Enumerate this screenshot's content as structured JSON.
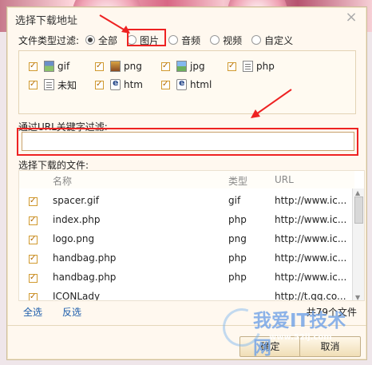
{
  "dialog": {
    "title": "选择下载地址",
    "close_icon": "close-icon"
  },
  "filters": {
    "label": "文件类型过滤:",
    "options": [
      {
        "label": "全部",
        "selected": true
      },
      {
        "label": "图片",
        "selected": false
      },
      {
        "label": "音频",
        "selected": false
      },
      {
        "label": "视频",
        "selected": false
      },
      {
        "label": "自定义",
        "selected": false
      }
    ]
  },
  "types": [
    {
      "label": "gif",
      "checked": true,
      "icon": "gif-file-icon"
    },
    {
      "label": "png",
      "checked": true,
      "icon": "png-file-icon"
    },
    {
      "label": "jpg",
      "checked": true,
      "icon": "jpg-file-icon"
    },
    {
      "label": "php",
      "checked": true,
      "icon": "php-file-icon"
    },
    {
      "label": "未知",
      "checked": true,
      "icon": "unknown-file-icon"
    },
    {
      "label": "htm",
      "checked": true,
      "icon": "htm-file-icon"
    },
    {
      "label": "html",
      "checked": true,
      "icon": "html-file-icon"
    }
  ],
  "url_filter": {
    "label": "通过URL关键字过滤:",
    "value": "",
    "placeholder": ""
  },
  "download": {
    "label": "选择下载的文件:",
    "headers": {
      "name": "名称",
      "type": "类型",
      "url": "URL"
    },
    "rows": [
      {
        "name": "spacer.gif",
        "type": "gif",
        "url": "http://www.ic..."
      },
      {
        "name": "index.php",
        "type": "php",
        "url": "http://www.ic..."
      },
      {
        "name": "logo.png",
        "type": "png",
        "url": "http://www.ic..."
      },
      {
        "name": "handbag.php",
        "type": "php",
        "url": "http://www.ic..."
      },
      {
        "name": "handbag.php",
        "type": "php",
        "url": "http://www.ic..."
      },
      {
        "name": "ICONLady",
        "type": "",
        "url": "http://t.qq.co..."
      }
    ]
  },
  "actions": {
    "select_all": "全选",
    "invert": "反选",
    "count": "共79个文件",
    "confirm": "确定",
    "cancel": "取消"
  },
  "watermark": {
    "text": "我爱IT技术网",
    "domain": "www.52ij.com"
  },
  "colors": {
    "highlight": "#ee2222",
    "link": "#1c5cab",
    "panel": "#fff8ef"
  }
}
